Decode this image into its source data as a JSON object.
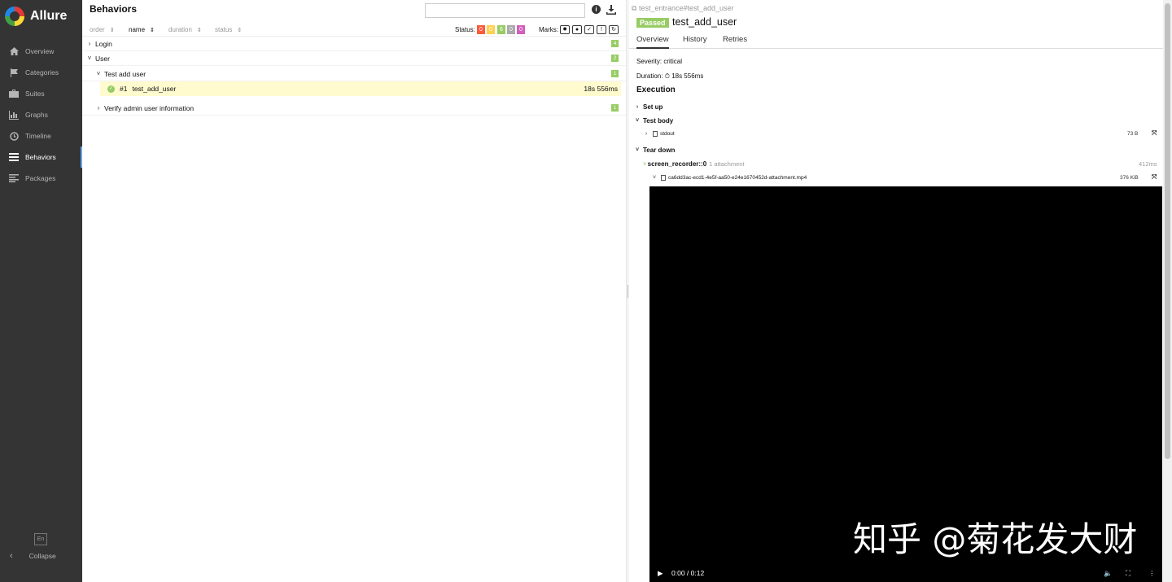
{
  "sidebar": {
    "brand": "Allure",
    "items": [
      {
        "label": "Overview"
      },
      {
        "label": "Categories"
      },
      {
        "label": "Suites"
      },
      {
        "label": "Graphs"
      },
      {
        "label": "Timeline"
      },
      {
        "label": "Behaviors"
      },
      {
        "label": "Packages"
      }
    ],
    "lang": "En",
    "collapse": "Collapse"
  },
  "behaviors": {
    "title": "Behaviors",
    "search_value": "",
    "sort": {
      "order": "order",
      "name": "name",
      "duration": "duration",
      "status": "status"
    },
    "status_label": "Status:",
    "status_counts": [
      {
        "value": "0",
        "color": "#fd5a3e"
      },
      {
        "value": "0",
        "color": "#ffd050"
      },
      {
        "value": "6",
        "color": "#97cc64"
      },
      {
        "value": "0",
        "color": "#aaaaaa"
      },
      {
        "value": "0",
        "color": "#d35ebe"
      }
    ],
    "marks_label": "Marks:",
    "tree": {
      "login": {
        "label": "Login",
        "count": "4"
      },
      "user": {
        "label": "User",
        "count": "2"
      },
      "test_add_user": {
        "label": "Test add user",
        "count": "1"
      },
      "test_row": {
        "num": "#1",
        "name": "test_add_user",
        "duration": "18s 556ms"
      },
      "verify": {
        "label": "Verify admin user information",
        "count": "1"
      }
    }
  },
  "detail": {
    "path": "test_entrance#test_add_user",
    "status": "Passed",
    "name": "test_add_user",
    "tabs": [
      "Overview",
      "History",
      "Retries"
    ],
    "severity": "Severity: critical",
    "duration_label": "Duration:",
    "duration_value": "18s 556ms",
    "execution": "Execution",
    "setup": "Set up",
    "test_body": "Test body",
    "stdout": {
      "name": "stdout",
      "size": "73 B"
    },
    "tear_down": "Tear down",
    "recorder": {
      "name": "screen_recorder::0",
      "attachments": "1 attachment",
      "duration": "412ms"
    },
    "video_file": {
      "name": "ca6dd3ac-ecd1-4e5f-aa50-e24e1670452d-attachment.mp4",
      "size": "376 KiB"
    },
    "watermark": "知乎 @菊花发大财",
    "video_time": "0:00 / 0:12"
  }
}
